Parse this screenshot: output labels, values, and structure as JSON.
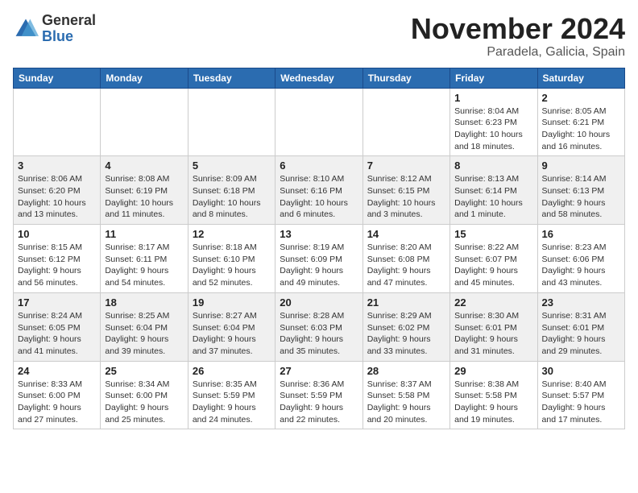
{
  "header": {
    "logo_general": "General",
    "logo_blue": "Blue",
    "month_title": "November 2024",
    "location": "Paradela, Galicia, Spain"
  },
  "weekdays": [
    "Sunday",
    "Monday",
    "Tuesday",
    "Wednesday",
    "Thursday",
    "Friday",
    "Saturday"
  ],
  "weeks": [
    [
      {
        "day": "",
        "info": ""
      },
      {
        "day": "",
        "info": ""
      },
      {
        "day": "",
        "info": ""
      },
      {
        "day": "",
        "info": ""
      },
      {
        "day": "",
        "info": ""
      },
      {
        "day": "1",
        "info": "Sunrise: 8:04 AM\nSunset: 6:23 PM\nDaylight: 10 hours and 18 minutes."
      },
      {
        "day": "2",
        "info": "Sunrise: 8:05 AM\nSunset: 6:21 PM\nDaylight: 10 hours and 16 minutes."
      }
    ],
    [
      {
        "day": "3",
        "info": "Sunrise: 8:06 AM\nSunset: 6:20 PM\nDaylight: 10 hours and 13 minutes."
      },
      {
        "day": "4",
        "info": "Sunrise: 8:08 AM\nSunset: 6:19 PM\nDaylight: 10 hours and 11 minutes."
      },
      {
        "day": "5",
        "info": "Sunrise: 8:09 AM\nSunset: 6:18 PM\nDaylight: 10 hours and 8 minutes."
      },
      {
        "day": "6",
        "info": "Sunrise: 8:10 AM\nSunset: 6:16 PM\nDaylight: 10 hours and 6 minutes."
      },
      {
        "day": "7",
        "info": "Sunrise: 8:12 AM\nSunset: 6:15 PM\nDaylight: 10 hours and 3 minutes."
      },
      {
        "day": "8",
        "info": "Sunrise: 8:13 AM\nSunset: 6:14 PM\nDaylight: 10 hours and 1 minute."
      },
      {
        "day": "9",
        "info": "Sunrise: 8:14 AM\nSunset: 6:13 PM\nDaylight: 9 hours and 58 minutes."
      }
    ],
    [
      {
        "day": "10",
        "info": "Sunrise: 8:15 AM\nSunset: 6:12 PM\nDaylight: 9 hours and 56 minutes."
      },
      {
        "day": "11",
        "info": "Sunrise: 8:17 AM\nSunset: 6:11 PM\nDaylight: 9 hours and 54 minutes."
      },
      {
        "day": "12",
        "info": "Sunrise: 8:18 AM\nSunset: 6:10 PM\nDaylight: 9 hours and 52 minutes."
      },
      {
        "day": "13",
        "info": "Sunrise: 8:19 AM\nSunset: 6:09 PM\nDaylight: 9 hours and 49 minutes."
      },
      {
        "day": "14",
        "info": "Sunrise: 8:20 AM\nSunset: 6:08 PM\nDaylight: 9 hours and 47 minutes."
      },
      {
        "day": "15",
        "info": "Sunrise: 8:22 AM\nSunset: 6:07 PM\nDaylight: 9 hours and 45 minutes."
      },
      {
        "day": "16",
        "info": "Sunrise: 8:23 AM\nSunset: 6:06 PM\nDaylight: 9 hours and 43 minutes."
      }
    ],
    [
      {
        "day": "17",
        "info": "Sunrise: 8:24 AM\nSunset: 6:05 PM\nDaylight: 9 hours and 41 minutes."
      },
      {
        "day": "18",
        "info": "Sunrise: 8:25 AM\nSunset: 6:04 PM\nDaylight: 9 hours and 39 minutes."
      },
      {
        "day": "19",
        "info": "Sunrise: 8:27 AM\nSunset: 6:04 PM\nDaylight: 9 hours and 37 minutes."
      },
      {
        "day": "20",
        "info": "Sunrise: 8:28 AM\nSunset: 6:03 PM\nDaylight: 9 hours and 35 minutes."
      },
      {
        "day": "21",
        "info": "Sunrise: 8:29 AM\nSunset: 6:02 PM\nDaylight: 9 hours and 33 minutes."
      },
      {
        "day": "22",
        "info": "Sunrise: 8:30 AM\nSunset: 6:01 PM\nDaylight: 9 hours and 31 minutes."
      },
      {
        "day": "23",
        "info": "Sunrise: 8:31 AM\nSunset: 6:01 PM\nDaylight: 9 hours and 29 minutes."
      }
    ],
    [
      {
        "day": "24",
        "info": "Sunrise: 8:33 AM\nSunset: 6:00 PM\nDaylight: 9 hours and 27 minutes."
      },
      {
        "day": "25",
        "info": "Sunrise: 8:34 AM\nSunset: 6:00 PM\nDaylight: 9 hours and 25 minutes."
      },
      {
        "day": "26",
        "info": "Sunrise: 8:35 AM\nSunset: 5:59 PM\nDaylight: 9 hours and 24 minutes."
      },
      {
        "day": "27",
        "info": "Sunrise: 8:36 AM\nSunset: 5:59 PM\nDaylight: 9 hours and 22 minutes."
      },
      {
        "day": "28",
        "info": "Sunrise: 8:37 AM\nSunset: 5:58 PM\nDaylight: 9 hours and 20 minutes."
      },
      {
        "day": "29",
        "info": "Sunrise: 8:38 AM\nSunset: 5:58 PM\nDaylight: 9 hours and 19 minutes."
      },
      {
        "day": "30",
        "info": "Sunrise: 8:40 AM\nSunset: 5:57 PM\nDaylight: 9 hours and 17 minutes."
      }
    ]
  ]
}
